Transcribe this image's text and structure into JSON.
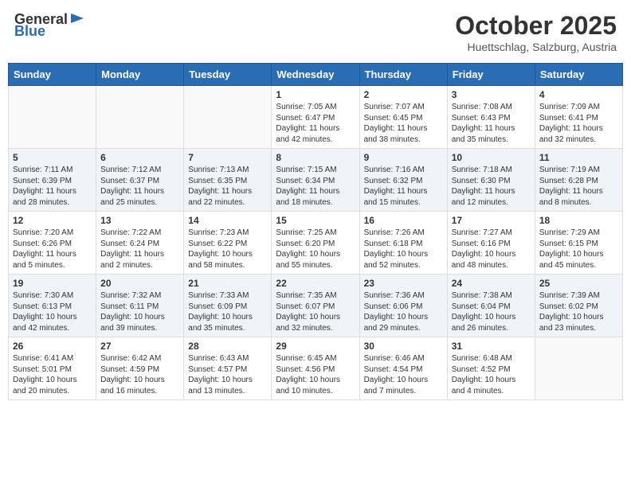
{
  "header": {
    "logo_general": "General",
    "logo_blue": "Blue",
    "title": "October 2025",
    "location": "Huettschlag, Salzburg, Austria"
  },
  "days_of_week": [
    "Sunday",
    "Monday",
    "Tuesday",
    "Wednesday",
    "Thursday",
    "Friday",
    "Saturday"
  ],
  "weeks": [
    [
      {
        "day": "",
        "sunrise": "",
        "sunset": "",
        "daylight": ""
      },
      {
        "day": "",
        "sunrise": "",
        "sunset": "",
        "daylight": ""
      },
      {
        "day": "",
        "sunrise": "",
        "sunset": "",
        "daylight": ""
      },
      {
        "day": "1",
        "sunrise": "Sunrise: 7:05 AM",
        "sunset": "Sunset: 6:47 PM",
        "daylight": "Daylight: 11 hours and 42 minutes."
      },
      {
        "day": "2",
        "sunrise": "Sunrise: 7:07 AM",
        "sunset": "Sunset: 6:45 PM",
        "daylight": "Daylight: 11 hours and 38 minutes."
      },
      {
        "day": "3",
        "sunrise": "Sunrise: 7:08 AM",
        "sunset": "Sunset: 6:43 PM",
        "daylight": "Daylight: 11 hours and 35 minutes."
      },
      {
        "day": "4",
        "sunrise": "Sunrise: 7:09 AM",
        "sunset": "Sunset: 6:41 PM",
        "daylight": "Daylight: 11 hours and 32 minutes."
      }
    ],
    [
      {
        "day": "5",
        "sunrise": "Sunrise: 7:11 AM",
        "sunset": "Sunset: 6:39 PM",
        "daylight": "Daylight: 11 hours and 28 minutes."
      },
      {
        "day": "6",
        "sunrise": "Sunrise: 7:12 AM",
        "sunset": "Sunset: 6:37 PM",
        "daylight": "Daylight: 11 hours and 25 minutes."
      },
      {
        "day": "7",
        "sunrise": "Sunrise: 7:13 AM",
        "sunset": "Sunset: 6:35 PM",
        "daylight": "Daylight: 11 hours and 22 minutes."
      },
      {
        "day": "8",
        "sunrise": "Sunrise: 7:15 AM",
        "sunset": "Sunset: 6:34 PM",
        "daylight": "Daylight: 11 hours and 18 minutes."
      },
      {
        "day": "9",
        "sunrise": "Sunrise: 7:16 AM",
        "sunset": "Sunset: 6:32 PM",
        "daylight": "Daylight: 11 hours and 15 minutes."
      },
      {
        "day": "10",
        "sunrise": "Sunrise: 7:18 AM",
        "sunset": "Sunset: 6:30 PM",
        "daylight": "Daylight: 11 hours and 12 minutes."
      },
      {
        "day": "11",
        "sunrise": "Sunrise: 7:19 AM",
        "sunset": "Sunset: 6:28 PM",
        "daylight": "Daylight: 11 hours and 8 minutes."
      }
    ],
    [
      {
        "day": "12",
        "sunrise": "Sunrise: 7:20 AM",
        "sunset": "Sunset: 6:26 PM",
        "daylight": "Daylight: 11 hours and 5 minutes."
      },
      {
        "day": "13",
        "sunrise": "Sunrise: 7:22 AM",
        "sunset": "Sunset: 6:24 PM",
        "daylight": "Daylight: 11 hours and 2 minutes."
      },
      {
        "day": "14",
        "sunrise": "Sunrise: 7:23 AM",
        "sunset": "Sunset: 6:22 PM",
        "daylight": "Daylight: 10 hours and 58 minutes."
      },
      {
        "day": "15",
        "sunrise": "Sunrise: 7:25 AM",
        "sunset": "Sunset: 6:20 PM",
        "daylight": "Daylight: 10 hours and 55 minutes."
      },
      {
        "day": "16",
        "sunrise": "Sunrise: 7:26 AM",
        "sunset": "Sunset: 6:18 PM",
        "daylight": "Daylight: 10 hours and 52 minutes."
      },
      {
        "day": "17",
        "sunrise": "Sunrise: 7:27 AM",
        "sunset": "Sunset: 6:16 PM",
        "daylight": "Daylight: 10 hours and 48 minutes."
      },
      {
        "day": "18",
        "sunrise": "Sunrise: 7:29 AM",
        "sunset": "Sunset: 6:15 PM",
        "daylight": "Daylight: 10 hours and 45 minutes."
      }
    ],
    [
      {
        "day": "19",
        "sunrise": "Sunrise: 7:30 AM",
        "sunset": "Sunset: 6:13 PM",
        "daylight": "Daylight: 10 hours and 42 minutes."
      },
      {
        "day": "20",
        "sunrise": "Sunrise: 7:32 AM",
        "sunset": "Sunset: 6:11 PM",
        "daylight": "Daylight: 10 hours and 39 minutes."
      },
      {
        "day": "21",
        "sunrise": "Sunrise: 7:33 AM",
        "sunset": "Sunset: 6:09 PM",
        "daylight": "Daylight: 10 hours and 35 minutes."
      },
      {
        "day": "22",
        "sunrise": "Sunrise: 7:35 AM",
        "sunset": "Sunset: 6:07 PM",
        "daylight": "Daylight: 10 hours and 32 minutes."
      },
      {
        "day": "23",
        "sunrise": "Sunrise: 7:36 AM",
        "sunset": "Sunset: 6:06 PM",
        "daylight": "Daylight: 10 hours and 29 minutes."
      },
      {
        "day": "24",
        "sunrise": "Sunrise: 7:38 AM",
        "sunset": "Sunset: 6:04 PM",
        "daylight": "Daylight: 10 hours and 26 minutes."
      },
      {
        "day": "25",
        "sunrise": "Sunrise: 7:39 AM",
        "sunset": "Sunset: 6:02 PM",
        "daylight": "Daylight: 10 hours and 23 minutes."
      }
    ],
    [
      {
        "day": "26",
        "sunrise": "Sunrise: 6:41 AM",
        "sunset": "Sunset: 5:01 PM",
        "daylight": "Daylight: 10 hours and 20 minutes."
      },
      {
        "day": "27",
        "sunrise": "Sunrise: 6:42 AM",
        "sunset": "Sunset: 4:59 PM",
        "daylight": "Daylight: 10 hours and 16 minutes."
      },
      {
        "day": "28",
        "sunrise": "Sunrise: 6:43 AM",
        "sunset": "Sunset: 4:57 PM",
        "daylight": "Daylight: 10 hours and 13 minutes."
      },
      {
        "day": "29",
        "sunrise": "Sunrise: 6:45 AM",
        "sunset": "Sunset: 4:56 PM",
        "daylight": "Daylight: 10 hours and 10 minutes."
      },
      {
        "day": "30",
        "sunrise": "Sunrise: 6:46 AM",
        "sunset": "Sunset: 4:54 PM",
        "daylight": "Daylight: 10 hours and 7 minutes."
      },
      {
        "day": "31",
        "sunrise": "Sunrise: 6:48 AM",
        "sunset": "Sunset: 4:52 PM",
        "daylight": "Daylight: 10 hours and 4 minutes."
      },
      {
        "day": "",
        "sunrise": "",
        "sunset": "",
        "daylight": ""
      }
    ]
  ]
}
